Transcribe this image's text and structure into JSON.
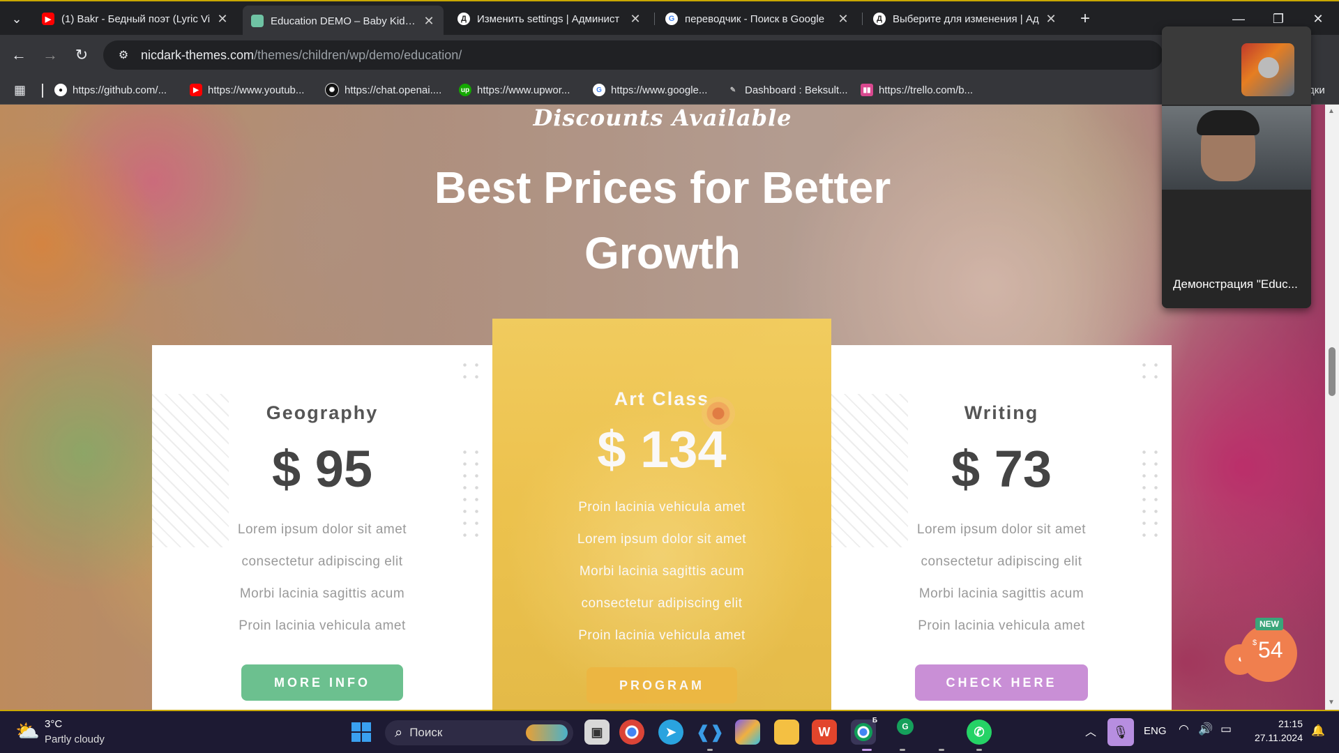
{
  "browser": {
    "tabs": [
      {
        "title": "(1) Bakr - Бедный поэт (Lyric Vi",
        "icon": "youtube-icon",
        "active": false
      },
      {
        "title": "Education DEMO – Baby Kids Pr",
        "icon": "site-favicon",
        "active": true
      },
      {
        "title": "Изменить settings | Админист",
        "icon": "django-icon",
        "active": false
      },
      {
        "title": "переводчик - Поиск в Google",
        "icon": "google-icon",
        "active": false
      },
      {
        "title": "Выберите для изменения | Ад",
        "icon": "django-icon",
        "active": false
      }
    ],
    "new_tab": "+",
    "url_host": "nicdark-themes.com",
    "url_path": "/themes/children/wp/demo/education/",
    "bookmarks": [
      {
        "label": "https://github.com/...",
        "icon": "github-icon"
      },
      {
        "label": "https://www.youtub...",
        "icon": "youtube-icon"
      },
      {
        "label": "https://chat.openai....",
        "icon": "openai-icon"
      },
      {
        "label": "https://www.upwor...",
        "icon": "upwork-icon"
      },
      {
        "label": "https://www.google...",
        "icon": "google-icon"
      },
      {
        "label": "Dashboard : Beksult...",
        "icon": "dashboard-icon"
      },
      {
        "label": "https://trello.com/b...",
        "icon": "trello-icon"
      }
    ],
    "bookmarks_overflow": "дки"
  },
  "page": {
    "script_heading": "Discounts Available",
    "title": "Best Prices for Better Growth",
    "cards": [
      {
        "name": "Geography",
        "price": "$ 95",
        "features": [
          "Lorem ipsum dolor sit amet",
          "consectetur adipiscing elit",
          "Morbi lacinia sagittis acum",
          "Proin lacinia vehicula amet"
        ],
        "button": "MORE INFO",
        "button_color": "#6cc08f"
      },
      {
        "name": "Art Class",
        "price": "$ 134",
        "features": [
          "Proin lacinia vehicula amet",
          "Lorem ipsum dolor sit amet",
          "Morbi lacinia sagittis acum",
          "consectetur adipiscing elit",
          "Proin lacinia vehicula amet"
        ],
        "button": "PROGRAM",
        "button_color": "#f0b93e"
      },
      {
        "name": "Writing",
        "price": "$ 73",
        "features": [
          "Lorem ipsum dolor sit amet",
          "consectetur adipiscing elit",
          "Morbi lacinia sagittis acum",
          "Proin lacinia vehicula amet"
        ],
        "button": "CHECK HERE",
        "button_color": "#c98fd6"
      }
    ],
    "promo_badge": {
      "new": "NEW",
      "currency": "$",
      "price": "54"
    }
  },
  "meeting": {
    "caption": "Демонстрация \"Educ..."
  },
  "taskbar": {
    "weather_temp": "3°C",
    "weather_text": "Partly cloudy",
    "search_placeholder": "Поиск",
    "lang": "ENG",
    "time": "21:15",
    "date": "27.11.2024",
    "chrome_badge": "Б",
    "grammarly_badge": "G"
  },
  "colors": {
    "accent_yellow": "#f0c54a",
    "green_button": "#6cc08f",
    "purple_button": "#c98fd6",
    "promo_orange": "#f07f4e"
  }
}
